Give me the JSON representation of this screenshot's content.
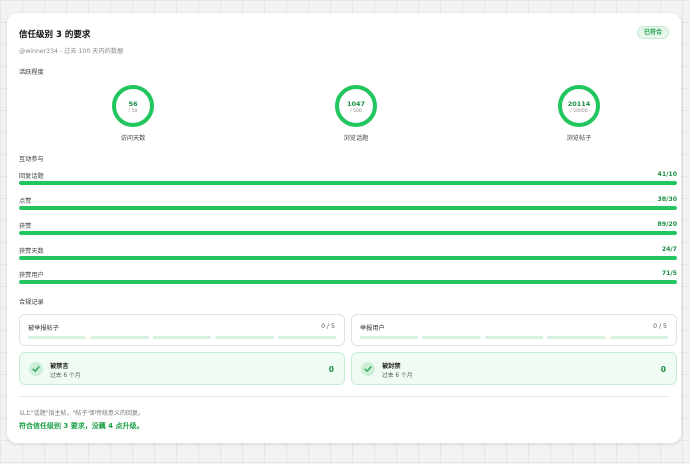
{
  "header": {
    "title": "信任级别 3 的要求",
    "badge": "已符合",
    "subtitle": "@winner334 - 过去 100 天内的数据"
  },
  "activity": {
    "label": "活跃程度",
    "gauges": [
      {
        "value": "56",
        "target": "/ 50",
        "label": "访问天数",
        "progress": 1.0
      },
      {
        "value": "1047",
        "target": "/ 500",
        "label": "浏览话题",
        "progress": 1.0
      },
      {
        "value": "20114",
        "target": "/ 20000",
        "label": "浏览帖子",
        "progress": 1.0
      }
    ]
  },
  "interaction": {
    "label": "互动参与",
    "rows": [
      {
        "name": "回复话题",
        "ratio": "41/10",
        "progress": 1.0
      },
      {
        "name": "点赞",
        "ratio": "38/30",
        "progress": 1.0
      },
      {
        "name": "获赞",
        "ratio": "89/20",
        "progress": 1.0
      },
      {
        "name": "获赞天数",
        "ratio": "24/7",
        "progress": 1.0
      },
      {
        "name": "获赞用户",
        "ratio": "71/5",
        "progress": 1.0
      }
    ]
  },
  "compliance": {
    "label": "合规记录",
    "reported": [
      {
        "name": "被举报帖子",
        "count": "0 / 5"
      },
      {
        "name": "举报用户",
        "count": "0 / 5"
      }
    ],
    "bans": [
      {
        "name": "被禁言",
        "period": "过去 6 个月",
        "value": "0"
      },
      {
        "name": "被封禁",
        "period": "过去 6 个月",
        "value": "0"
      }
    ]
  },
  "footer": {
    "note": "以上\"话题\"指主帖，\"帖子\"即传统意义的回复。",
    "result": "符合信任级别 3 要求，没藕 4 点升级。"
  },
  "colors": {
    "accent": "#22c55e",
    "accent_text": "#1a8f42",
    "track": "#d7f0de"
  }
}
